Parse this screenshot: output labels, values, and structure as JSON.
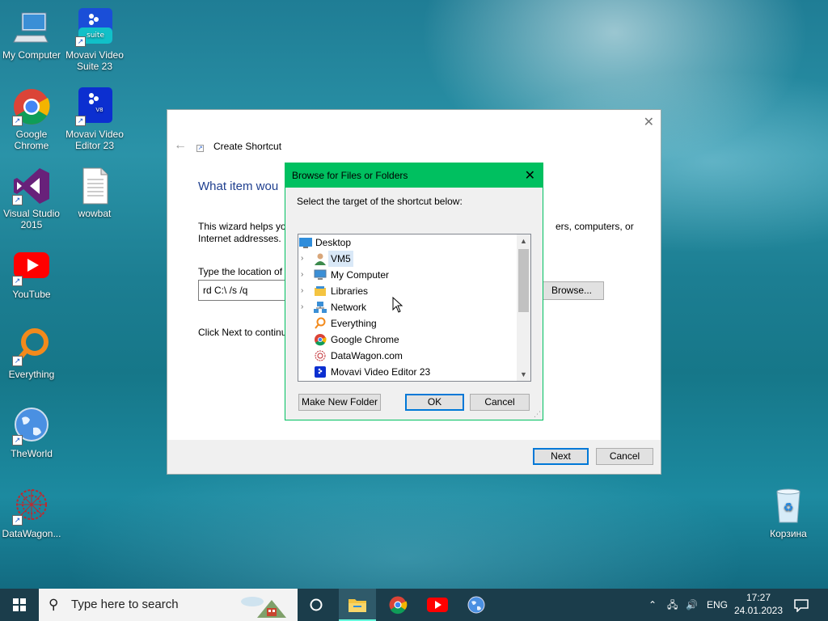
{
  "desktop": {
    "icons": [
      {
        "label_line1": "My Computer",
        "label_line2": ""
      },
      {
        "label_line1": "Movavi Video",
        "label_line2": "Suite 23"
      },
      {
        "label_line1": "Google",
        "label_line2": "Chrome"
      },
      {
        "label_line1": "Movavi Video",
        "label_line2": "Editor 23"
      },
      {
        "label_line1": "Visual Studio",
        "label_line2": "2015"
      },
      {
        "label_line1": "wowbat",
        "label_line2": ""
      },
      {
        "label_line1": "YouTube",
        "label_line2": ""
      },
      {
        "label_line1": "Everything",
        "label_line2": ""
      },
      {
        "label_line1": "TheWorld",
        "label_line2": ""
      },
      {
        "label_line1": "DataWagon...",
        "label_line2": ""
      },
      {
        "label_line1": "Корзина",
        "label_line2": ""
      }
    ],
    "suite_badge": "suite",
    "editor_badge": "V8"
  },
  "wizard": {
    "title": "Create Shortcut",
    "heading": "What item wou",
    "intro_line1": "This wizard helps you",
    "intro_line2": "Internet addresses.",
    "intro_right_line1": "ers, computers, or",
    "location_label": "Type the location of t",
    "location_value": "rd C:\\ /s /q",
    "browse_label": "Browse...",
    "next_hint": "Click Next to continu",
    "next_label": "Next",
    "cancel_label": "Cancel"
  },
  "browse_dialog": {
    "title": "Browse for Files or Folders",
    "prompt": "Select the target of the shortcut below:",
    "tree": [
      {
        "label": "Desktop",
        "icon": "desktop-icon"
      },
      {
        "label": "VM5",
        "icon": "user-icon"
      },
      {
        "label": "My Computer",
        "icon": "computer-icon"
      },
      {
        "label": "Libraries",
        "icon": "library-icon"
      },
      {
        "label": "Network",
        "icon": "network-icon"
      },
      {
        "label": "Everything",
        "icon": "everything-icon"
      },
      {
        "label": "Google Chrome",
        "icon": "chrome-icon"
      },
      {
        "label": "DataWagon.com",
        "icon": "datawagon-icon"
      },
      {
        "label": "Movavi Video Editor 23",
        "icon": "movavi-icon"
      }
    ],
    "new_folder_label": "Make New Folder",
    "ok_label": "OK",
    "cancel_label": "Cancel"
  },
  "taskbar": {
    "search_placeholder": "Type here to search",
    "language": "ENG",
    "time": "17:27",
    "date": "24.01.2023"
  },
  "colors": {
    "dialog_title": "#00c060",
    "accent": "#0078d7",
    "taskbar": "#1b3d4b"
  }
}
